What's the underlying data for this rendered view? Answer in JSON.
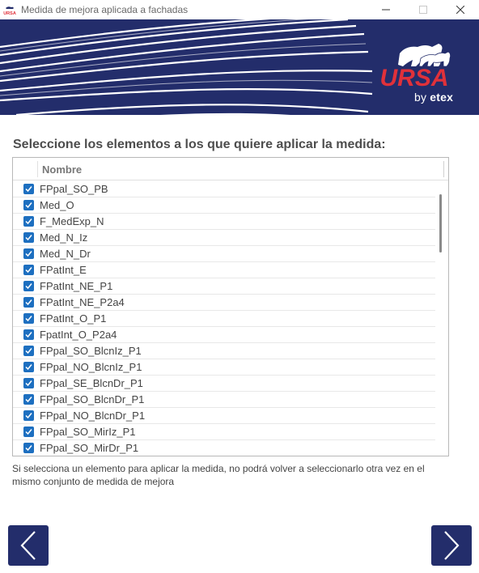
{
  "window": {
    "title": "Medida de mejora aplicada a fachadas",
    "icon": "ursa-app-icon",
    "icon_label": "URSA",
    "controls": [
      "minimize-icon",
      "maximize-icon",
      "close-icon"
    ]
  },
  "banner": {
    "logo_text": "URSA",
    "byline_by": "by",
    "byline_brand": "etex",
    "colors": {
      "background": "#232d6b",
      "logo_red": "#e0313a",
      "white": "#ffffff"
    }
  },
  "main": {
    "heading": "Seleccione los elementos a los que quiere aplicar la medida:",
    "list": {
      "column_header": "Nombre",
      "items": [
        {
          "label": "FPpal_SO_PB",
          "checked": true
        },
        {
          "label": "Med_O",
          "checked": true
        },
        {
          "label": "F_MedExp_N",
          "checked": true
        },
        {
          "label": "Med_N_Iz",
          "checked": true
        },
        {
          "label": "Med_N_Dr",
          "checked": true
        },
        {
          "label": "FPatInt_E",
          "checked": true
        },
        {
          "label": "FPatInt_NE_P1",
          "checked": true
        },
        {
          "label": "FPatInt_NE_P2a4",
          "checked": true
        },
        {
          "label": "FPatInt_O_P1",
          "checked": true
        },
        {
          "label": "FpatInt_O_P2a4",
          "checked": true
        },
        {
          "label": "FPpal_SO_BlcnIz_P1",
          "checked": true
        },
        {
          "label": "FPpal_NO_BlcnIz_P1",
          "checked": true
        },
        {
          "label": "FPpal_SE_BlcnDr_P1",
          "checked": true
        },
        {
          "label": "FPpal_SO_BlcnDr_P1",
          "checked": true
        },
        {
          "label": "FPpal_NO_BlcnDr_P1",
          "checked": true
        },
        {
          "label": "FPpal_SO_MirIz_P1",
          "checked": true
        },
        {
          "label": "FPpal_SO_MirDr_P1",
          "checked": true
        }
      ]
    },
    "note": "Si selecciona un elemento para aplicar la medida, no podrá volver a seleccionarlo otra vez en el mismo conjunto de medida de mejora"
  },
  "footer": {
    "prev_icon": "chevron-left-icon",
    "next_icon": "chevron-right-icon",
    "button_color": "#232d6b"
  },
  "colors": {
    "checkbox": "#1d6fc0",
    "heading_text": "#4d4d4d"
  }
}
